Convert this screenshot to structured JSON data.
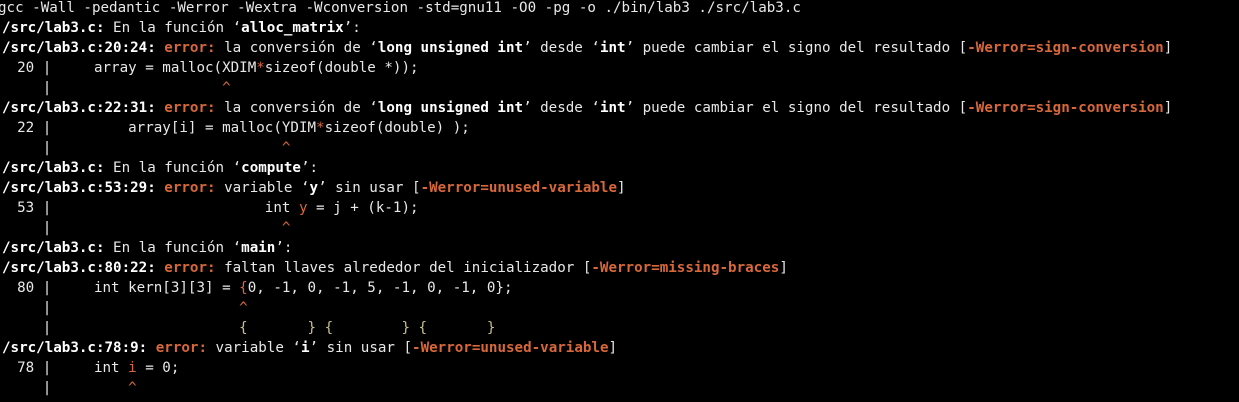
{
  "terminal": {
    "command": "gcc -Wall -pedantic -Werror -Wextra -Wconversion -std=gnu11 -O0 -pg -o ./bin/lab3 ./src/lab3.c",
    "diag_1": {
      "file_loc": "/src/lab3.c:",
      "in_function": " En la función ‘",
      "function": "alloc_matrix",
      "function_close": "’:"
    },
    "diag_2": {
      "loc": "/src/lab3.c:20:24:",
      "error_label": "error:",
      "msg_a": " la conversión de ‘",
      "type_a": "long unsigned int",
      "msg_b": "’ desde ‘",
      "type_b": "int",
      "msg_c": "’ puede cambiar el signo del resultado [",
      "flag": "-Werror=sign-conversion",
      "close": "]"
    },
    "code_20": {
      "gutter": "  20 |",
      "pre": "     array = malloc(XDIM",
      "hl": "*",
      "post": "sizeof(double *));"
    },
    "caret_20": {
      "gutter": "     |",
      "pad": "                    ",
      "mark": "^"
    },
    "diag_3": {
      "loc": "/src/lab3.c:22:31:",
      "error_label": "error:",
      "msg_a": " la conversión de ‘",
      "type_a": "long unsigned int",
      "msg_b": "’ desde ‘",
      "type_b": "int",
      "msg_c": "’ puede cambiar el signo del resultado [",
      "flag": "-Werror=sign-conversion",
      "close": "]"
    },
    "code_22": {
      "gutter": "  22 |",
      "pre": "         array[i] = malloc(YDIM",
      "hl": "*",
      "post": "sizeof(double) );"
    },
    "caret_22": {
      "gutter": "     |",
      "pad": "                           ",
      "mark": "^"
    },
    "diag_4": {
      "file_loc": "/src/lab3.c:",
      "in_function": " En la función ‘",
      "function": "compute",
      "function_close": "’:"
    },
    "diag_5": {
      "loc": "/src/lab3.c:53:29:",
      "error_label": "error:",
      "msg_a": " variable ‘",
      "var": "y",
      "msg_b": "’ sin usar [",
      "flag": "-Werror=unused-variable",
      "close": "]"
    },
    "code_53": {
      "gutter": "  53 |",
      "pre": "                         int ",
      "hl": "y",
      "post": " = j + (k-1);"
    },
    "caret_53": {
      "gutter": "     |",
      "pad": "                           ",
      "mark": "^"
    },
    "diag_6": {
      "file_loc": "/src/lab3.c:",
      "in_function": " En la función ‘",
      "function": "main",
      "function_close": "’:"
    },
    "diag_7": {
      "loc": "/src/lab3.c:80:22:",
      "error_label": "error:",
      "msg": " faltan llaves alrededor del inicializador [",
      "flag": "-Werror=missing-braces",
      "close": "]"
    },
    "code_80": {
      "gutter": "  80 |",
      "pre": "     int kern[3][3] = ",
      "hl": "{",
      "post": "0, -1, 0, -1, 5, -1, 0, -1, 0};"
    },
    "caret_80": {
      "gutter": "     |",
      "pad": "                      ",
      "mark": "^"
    },
    "fixit_80": {
      "gutter": "     |",
      "pad": "                      ",
      "text": "{       } {        } {       }"
    },
    "diag_8": {
      "loc": "/src/lab3.c:78:9:",
      "error_label": "error:",
      "msg_a": " variable ‘",
      "var": "i",
      "msg_b": "’ sin usar [",
      "flag": "-Werror=unused-variable",
      "close": "]"
    },
    "code_78": {
      "gutter": "  78 |",
      "pre": "     int ",
      "hl": "i",
      "post": " = 0;"
    },
    "caret_78": {
      "gutter": "     |",
      "pad": "         ",
      "mark": "^"
    }
  }
}
